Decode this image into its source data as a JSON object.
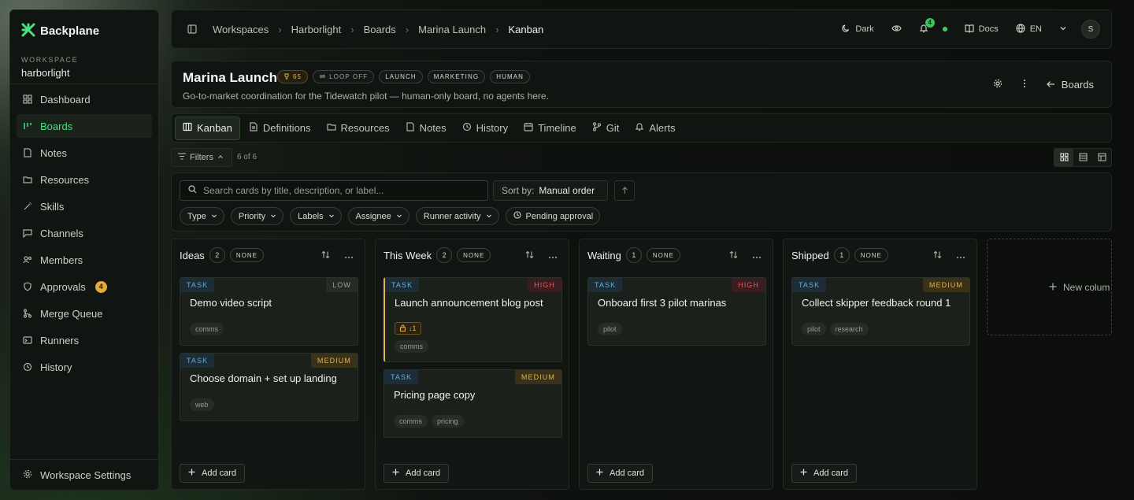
{
  "brand": {
    "name": "Backplane",
    "accent": "#4ade80"
  },
  "workspace": {
    "label": "WORKSPACE",
    "name": "harborlight"
  },
  "sidebar": {
    "items": [
      {
        "label": "Dashboard",
        "icon": "grid-icon"
      },
      {
        "label": "Boards",
        "icon": "boards-icon",
        "active": true
      },
      {
        "label": "Notes",
        "icon": "note-icon"
      },
      {
        "label": "Resources",
        "icon": "folder-icon"
      },
      {
        "label": "Skills",
        "icon": "wand-icon"
      },
      {
        "label": "Channels",
        "icon": "chat-icon"
      },
      {
        "label": "Members",
        "icon": "users-icon"
      },
      {
        "label": "Approvals",
        "icon": "shield-icon",
        "badge": "4"
      },
      {
        "label": "Merge Queue",
        "icon": "merge-icon"
      },
      {
        "label": "Runners",
        "icon": "runner-icon"
      },
      {
        "label": "History",
        "icon": "history-icon"
      }
    ],
    "settings_label": "Workspace Settings"
  },
  "topbar": {
    "breadcrumbs": [
      "Workspaces",
      "Harborlight",
      "Boards",
      "Marina Launch",
      "Kanban"
    ],
    "theme_label": "Dark",
    "notif_count": "4",
    "docs_label": "Docs",
    "lang_label": "EN",
    "avatar_initial": "S"
  },
  "board": {
    "title": "Marina Launch",
    "score": "65",
    "loop": "LOOP OFF",
    "chips": [
      "LAUNCH",
      "MARKETING",
      "HUMAN"
    ],
    "description": "Go-to-market coordination for the Tidewatch pilot — human-only board, no agents here.",
    "back_label": "Boards"
  },
  "tabs": [
    {
      "label": "Kanban",
      "icon": "kanban-icon",
      "active": true
    },
    {
      "label": "Definitions",
      "icon": "document-icon"
    },
    {
      "label": "Resources",
      "icon": "folder-icon"
    },
    {
      "label": "Notes",
      "icon": "note-icon"
    },
    {
      "label": "History",
      "icon": "history-icon"
    },
    {
      "label": "Timeline",
      "icon": "timeline-icon"
    },
    {
      "label": "Git",
      "icon": "git-icon"
    },
    {
      "label": "Alerts",
      "icon": "bell-icon"
    }
  ],
  "filters": {
    "label": "Filters",
    "count": "6 of 6"
  },
  "search": {
    "placeholder": "Search cards by title, description, or label..."
  },
  "sort": {
    "label": "Sort by:",
    "value": "Manual order"
  },
  "filter_chips": [
    "Type",
    "Priority",
    "Labels",
    "Assignee",
    "Runner activity",
    "Pending approval"
  ],
  "columns": [
    {
      "title": "Ideas",
      "count": "2",
      "wip": "NONE",
      "cards": [
        {
          "type": "TASK",
          "priority": "LOW",
          "title": "Demo video script",
          "labels": [
            "comms"
          ]
        },
        {
          "type": "TASK",
          "priority": "MEDIUM",
          "title": "Choose domain + set up landing",
          "labels": [
            "web"
          ]
        }
      ]
    },
    {
      "title": "This Week",
      "count": "2",
      "wip": "NONE",
      "cards": [
        {
          "type": "TASK",
          "priority": "HIGH",
          "title": "Launch announcement blog post",
          "lock": "↓1",
          "labels": [
            "comms"
          ]
        },
        {
          "type": "TASK",
          "priority": "MEDIUM",
          "title": "Pricing page copy",
          "labels": [
            "comms",
            "pricing"
          ]
        }
      ]
    },
    {
      "title": "Waiting",
      "count": "1",
      "wip": "NONE",
      "cards": [
        {
          "type": "TASK",
          "priority": "HIGH",
          "title": "Onboard first 3 pilot marinas",
          "labels": [
            "pilot"
          ]
        }
      ]
    },
    {
      "title": "Shipped",
      "count": "1",
      "wip": "NONE",
      "cards": [
        {
          "type": "TASK",
          "priority": "MEDIUM",
          "title": "Collect skipper feedback round 1",
          "labels": [
            "pilot",
            "research"
          ]
        }
      ]
    }
  ],
  "add_card_label": "Add card",
  "new_column_label": "New colum"
}
